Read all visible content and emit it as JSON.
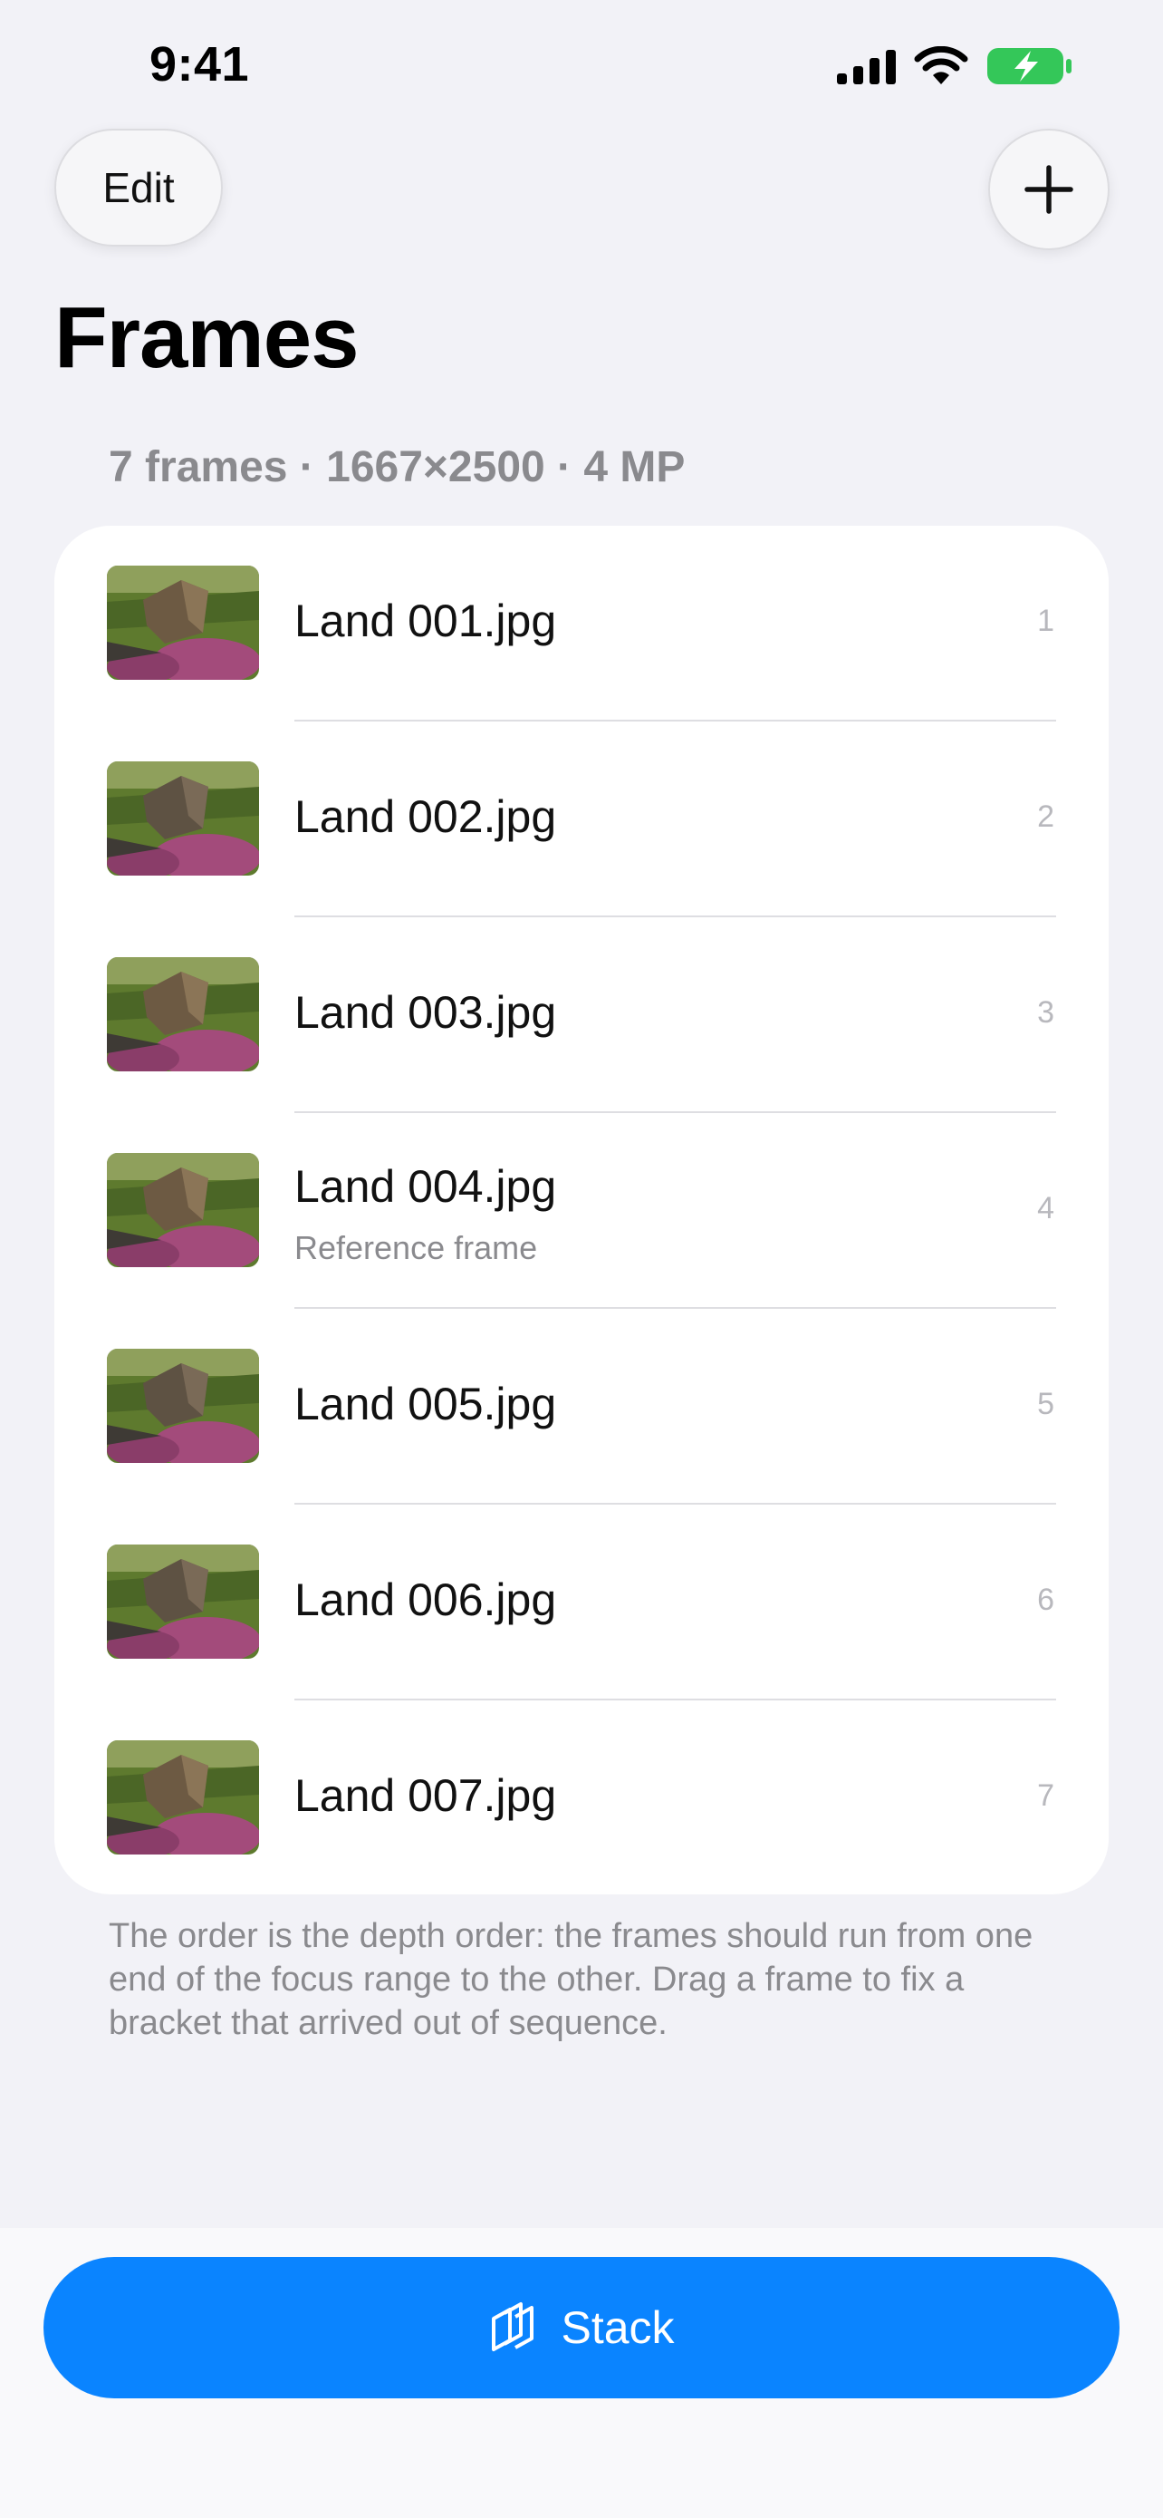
{
  "status": {
    "time": "9:41"
  },
  "nav": {
    "edit_label": "Edit",
    "add_icon": "plus-icon"
  },
  "title": "Frames",
  "section_header": "7 frames · 1667×2500 · 4 MP",
  "frames": [
    {
      "name": "Land 001.jpg",
      "index": "1",
      "subtitle": ""
    },
    {
      "name": "Land 002.jpg",
      "index": "2",
      "subtitle": ""
    },
    {
      "name": "Land 003.jpg",
      "index": "3",
      "subtitle": ""
    },
    {
      "name": "Land 004.jpg",
      "index": "4",
      "subtitle": "Reference frame"
    },
    {
      "name": "Land 005.jpg",
      "index": "5",
      "subtitle": ""
    },
    {
      "name": "Land 006.jpg",
      "index": "6",
      "subtitle": ""
    },
    {
      "name": "Land 007.jpg",
      "index": "7",
      "subtitle": ""
    }
  ],
  "footer_note": "The order is the depth order: the frames should run from one end of the focus range to the other. Drag a frame to fix a bracket that arrived out of sequence.",
  "stack_button": {
    "label": "Stack",
    "icon": "stack-icon"
  },
  "colors": {
    "accent": "#0a84ff",
    "battery": "#34c759",
    "background": "#f2f2f7"
  }
}
